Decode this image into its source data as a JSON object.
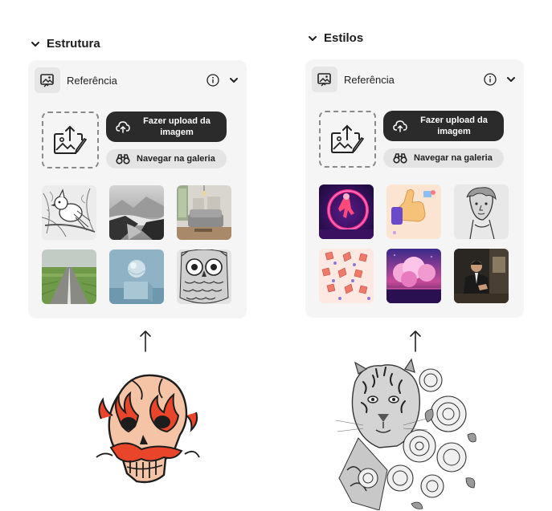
{
  "sections": [
    {
      "title": "Estrutura",
      "reference_label": "Referência",
      "upload_label": "Fazer upload da imagem",
      "gallery_label": "Navegar na galeria",
      "thumbnails": [
        "bird-sketch-thumbnail",
        "misty-landscape-thumbnail",
        "living-room-thumbnail",
        "road-field-thumbnail",
        "sphere-cube-thumbnail",
        "owl-pattern-thumbnail"
      ]
    },
    {
      "title": "Estilos",
      "reference_label": "Referência",
      "upload_label": "Fazer upload da imagem",
      "gallery_label": "Navegar na galeria",
      "thumbnails": [
        "neon-astronaut-thumbnail",
        "thumbs-up-3d-thumbnail",
        "statue-sketch-thumbnail",
        "hands-pattern-thumbnail",
        "pink-clouds-thumbnail",
        "man-portrait-thumbnail"
      ]
    }
  ],
  "colors": {
    "panel_bg": "#f5f5f5",
    "button_dark": "#2b2b2b",
    "button_light": "#e4e4e4",
    "flame": "#e8452a",
    "skull": "#f5c4a6"
  }
}
